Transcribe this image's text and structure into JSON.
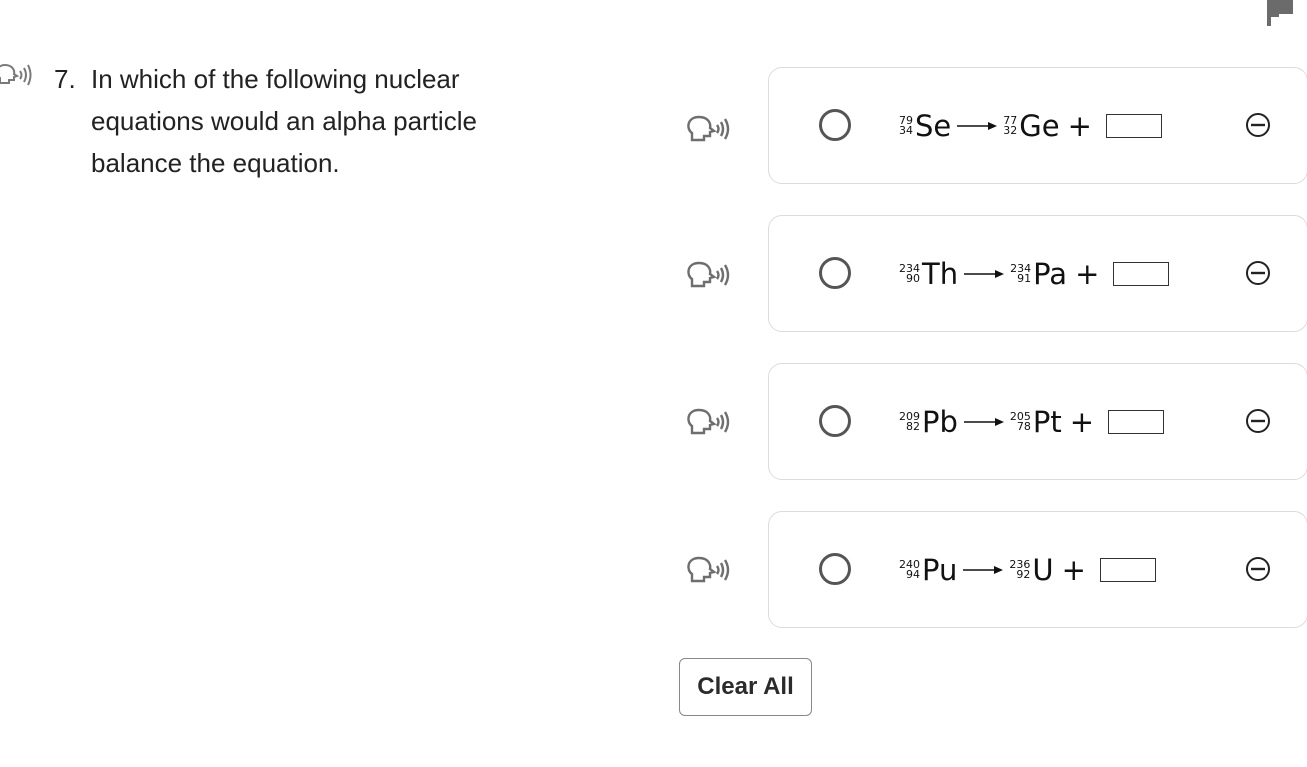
{
  "question": {
    "number": "7.",
    "text": "In which of the following nuclear equations would an alpha particle balance the equation."
  },
  "options": [
    {
      "reactant": {
        "mass": "79",
        "atomic": "34",
        "symbol": "Se"
      },
      "product": {
        "mass": "77",
        "atomic": "32",
        "symbol": "Ge"
      },
      "plus": "+",
      "selected": false
    },
    {
      "reactant": {
        "mass": "234",
        "atomic": "90",
        "symbol": "Th"
      },
      "product": {
        "mass": "234",
        "atomic": "91",
        "symbol": "Pa"
      },
      "plus": "+",
      "selected": false
    },
    {
      "reactant": {
        "mass": "209",
        "atomic": "82",
        "symbol": "Pb"
      },
      "product": {
        "mass": "205",
        "atomic": "78",
        "symbol": "Pt"
      },
      "plus": "+",
      "selected": false
    },
    {
      "reactant": {
        "mass": "240",
        "atomic": "94",
        "symbol": "Pu"
      },
      "product": {
        "mass": "236",
        "atomic": "92",
        "symbol": "U"
      },
      "plus": "+",
      "selected": false
    }
  ],
  "buttons": {
    "clear_all": "Clear All"
  },
  "icons": {
    "speaker": "text-to-speech-icon",
    "eliminate": "eliminate-option-icon",
    "flag": "flag-icon",
    "arrow": "reaction-arrow"
  },
  "colors": {
    "icon_gray": "#6e6e6e",
    "card_border": "#dcdcdc",
    "flag_gray": "#6b6b6b"
  }
}
